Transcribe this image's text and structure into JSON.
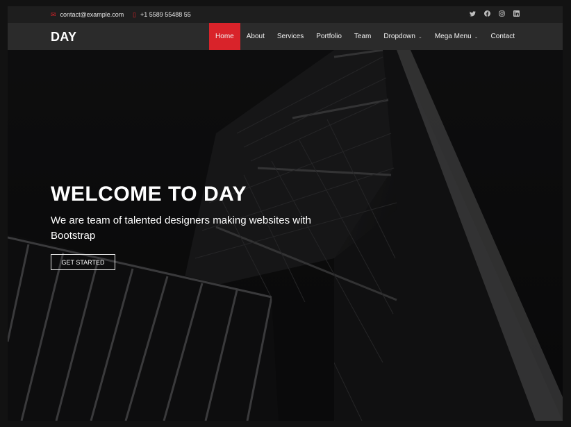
{
  "topbar": {
    "email": "contact@example.com",
    "phone": "+1 5589 55488 55",
    "socials": [
      "twitter-icon",
      "facebook-icon",
      "instagram-icon",
      "linkedin-icon"
    ]
  },
  "nav": {
    "logo": "DAY",
    "items": [
      {
        "label": "Home",
        "active": true
      },
      {
        "label": "About"
      },
      {
        "label": "Services"
      },
      {
        "label": "Portfolio"
      },
      {
        "label": "Team"
      },
      {
        "label": "Dropdown",
        "has_caret": true
      },
      {
        "label": "Mega Menu",
        "has_caret": true
      },
      {
        "label": "Contact"
      }
    ]
  },
  "hero": {
    "title": "WELCOME TO DAY",
    "subtitle": "We are team of talented designers making websites with Bootstrap",
    "cta": "GET STARTED"
  },
  "colors": {
    "accent": "#d9232a",
    "navbar": "#2b2b2b",
    "topbar": "#1e1e1e"
  }
}
